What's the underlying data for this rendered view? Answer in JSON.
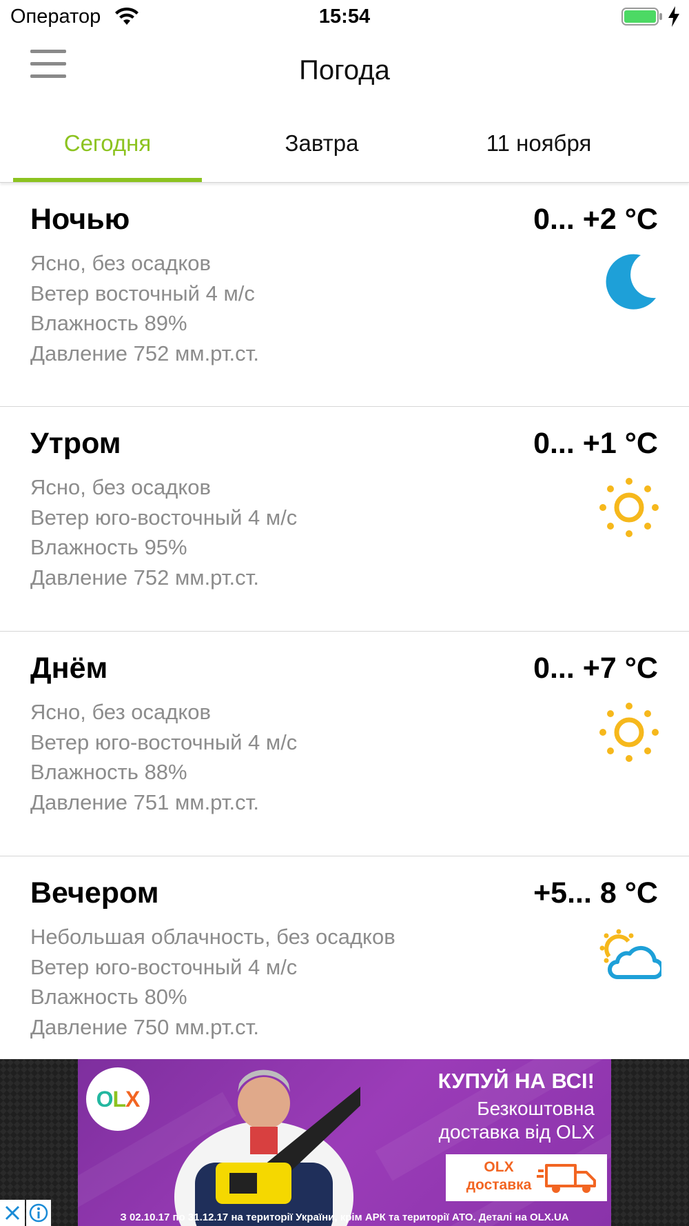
{
  "status_bar": {
    "carrier": "Оператор",
    "time": "15:54",
    "battery_color": "#4cd964"
  },
  "nav": {
    "title": "Погода",
    "menu_icon": "hamburger-menu-icon"
  },
  "tabs": [
    {
      "label": "Сегодня",
      "active": true
    },
    {
      "label": "Завтра",
      "active": false
    },
    {
      "label": "11 ноября",
      "active": false
    }
  ],
  "colors": {
    "accent": "#8cc320",
    "secondary_text": "#8c8c8c",
    "moon": "#1ea0d8",
    "sun": "#f6b81c",
    "cloud": "#1ea0d8"
  },
  "forecast": [
    {
      "period": "Ночью",
      "temp": "0... +2 °C",
      "condition": "Ясно, без осадков",
      "wind": "Ветер восточный 4 м/с",
      "humidity": "Влажность 89%",
      "pressure": "Давление 752 мм.рт.ст.",
      "icon": "moon-icon"
    },
    {
      "period": "Утром",
      "temp": "0... +1 °C",
      "condition": "Ясно, без осадков",
      "wind": "Ветер юго-восточный 4 м/с",
      "humidity": "Влажность 95%",
      "pressure": "Давление 752 мм.рт.ст.",
      "icon": "sun-icon"
    },
    {
      "period": "Днём",
      "temp": "0... +7 °C",
      "condition": "Ясно, без осадков",
      "wind": "Ветер юго-восточный 4 м/с",
      "humidity": "Влажность 88%",
      "pressure": "Давление 751 мм.рт.ст.",
      "icon": "sun-icon"
    },
    {
      "period": "Вечером",
      "temp": "+5... 8 °C",
      "condition": "Небольшая облачность, без осадков",
      "wind": "Ветер юго-восточный 4 м/с",
      "humidity": "Влажность 80%",
      "pressure": "Давление 750 мм.рт.ст.",
      "icon": "partly-cloudy-icon"
    }
  ],
  "ad": {
    "logo": "OLX",
    "headline": "КУПУЙ НА ВСІ!",
    "subline_1": "Безкоштовна",
    "subline_2": "доставка від OLX",
    "delivery_line_1": "OLX",
    "delivery_line_2": "доставка",
    "footnote": "З 02.10.17 по 31.12.17 на території України, крім АРК та території АТО. Деталі на OLX.UA",
    "close_icon": "close-icon",
    "info_icon": "info-icon"
  }
}
